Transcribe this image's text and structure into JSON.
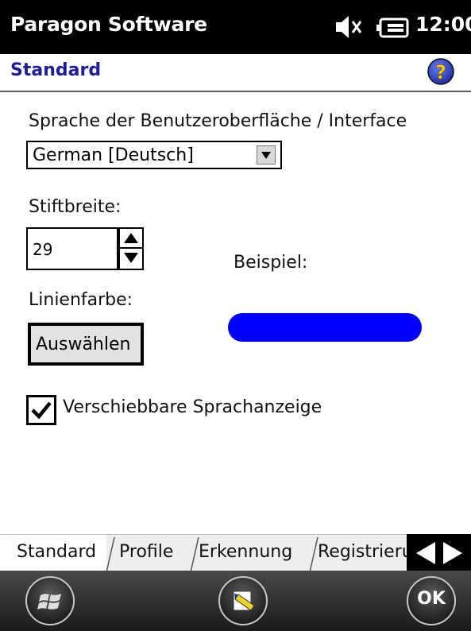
{
  "titlebar": {
    "app_title": "Paragon Software",
    "clock": "12:00",
    "icons": [
      "speaker-icon",
      "battery-icon"
    ]
  },
  "header": {
    "title": "Standard",
    "help_icon": "help-icon"
  },
  "settings": {
    "language_label": "Sprache der Benutzeroberfläche / Interface",
    "language_value": "German [Deutsch]",
    "pen_width_label": "Stiftbreite:",
    "pen_width_value": "29",
    "example_label": "Beispiel:",
    "line_color_label": "Linienfarbe:",
    "select_button": "Auswählen",
    "sample_line_color": "#0000ff",
    "movable_display_label": "Verschiebbare Sprachanzeige",
    "movable_display_checked": true
  },
  "tabs": [
    {
      "label": "Standard",
      "active": true
    },
    {
      "label": "Profile",
      "active": false
    },
    {
      "label": "Erkennung",
      "active": false
    },
    {
      "label": "Registrierung",
      "active": false
    }
  ],
  "bottombar": {
    "ok_label": "OK",
    "icons": [
      "windows-start-icon",
      "input-panel-icon"
    ]
  },
  "colors": {
    "header_title": "#1c1c9c",
    "bar_background": "#000000"
  }
}
